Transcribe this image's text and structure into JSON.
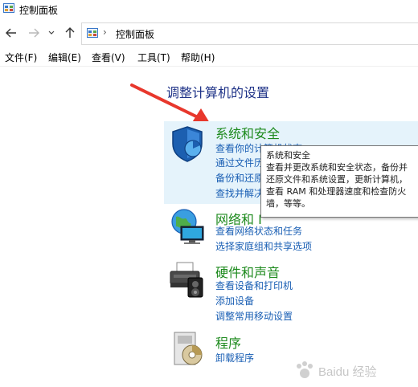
{
  "window": {
    "title": "控制面板"
  },
  "address_bar": {
    "crumb": "控制面板",
    "separator": "›"
  },
  "menu": [
    "文件(F)",
    "编辑(E)",
    "查看(V)",
    "工具(T)",
    "帮助(H)"
  ],
  "heading": "调整计算机的设置",
  "categories": [
    {
      "title": "系统和安全",
      "links": [
        "查看你的计算机状态",
        "通过文件历",
        "备份和还原",
        "查找并解决"
      ]
    },
    {
      "title": "网络和 I",
      "links": [
        "查看网络状态和任务",
        "选择家庭组和共享选项"
      ]
    },
    {
      "title": "硬件和声音",
      "links": [
        "查看设备和打印机",
        "添加设备",
        "调整常用移动设置"
      ]
    },
    {
      "title": "程序",
      "links": [
        "卸载程序"
      ]
    }
  ],
  "tooltip": {
    "title": "系统和安全",
    "lines": [
      "查看并更改系统和安全状态，备份并",
      "还原文件和系统设置，更新计算机，",
      "查看 RAM 和处理器速度和检查防火",
      "墙，等等。"
    ]
  },
  "watermark": "Baidu 经验",
  "colors": {
    "heading": "#1e3287",
    "category_title": "#1d8a1d",
    "link": "#1a5fb4",
    "highlight": "#e5f3fb",
    "arrow": "#e8372c"
  },
  "icons": {
    "window": "control-panel-icon",
    "back": "arrow-left-icon",
    "forward": "arrow-right-icon",
    "recent": "chevron-down-icon",
    "up": "arrow-up-icon",
    "system_security": "shield-icon",
    "network": "globe-network-icon",
    "hardware": "printer-icon",
    "programs": "programs-disc-icon"
  }
}
